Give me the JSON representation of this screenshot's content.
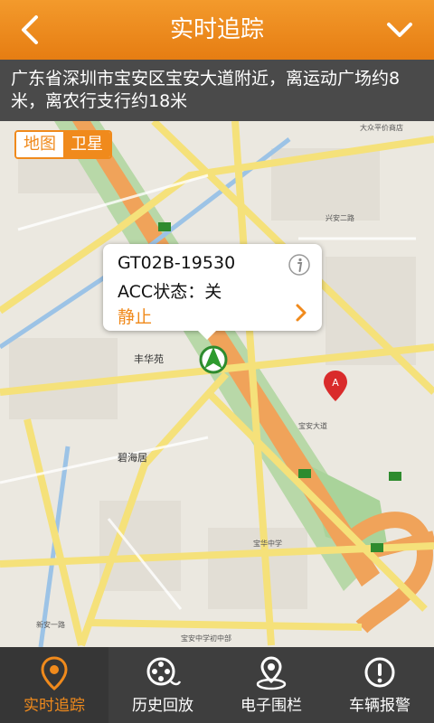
{
  "header": {
    "title": "实时追踪",
    "back_icon": "chevron-left-icon",
    "menu_icon": "chevron-down-icon"
  },
  "address": "广东省深圳市宝安区宝安大道附近，离运动广场约8米，离农行支行约18米",
  "map_type": {
    "map_label": "地图",
    "satellite_label": "卫星",
    "selected": "卫星"
  },
  "map_labels": {
    "fenghuayuan": "丰华苑",
    "bihaiju": "碧海居",
    "dazhong": "大众平价商店",
    "baohua_zhongxue": "宝华中学",
    "xingan_ershi": "兴安二路",
    "badao_a": "宝安大道",
    "xinan_yilu": "新安一路",
    "xingan_road": "宝安中学初中部"
  },
  "popup": {
    "device": "GT02B-19530",
    "acc": "ACC状态：关",
    "status": "静止",
    "info_icon": "info-icon",
    "more_icon": "chevron-right-icon"
  },
  "tabs": [
    {
      "label": "实时追踪",
      "icon": "location-pin-icon",
      "active": true
    },
    {
      "label": "历史回放",
      "icon": "film-reel-icon",
      "active": false
    },
    {
      "label": "电子围栏",
      "icon": "geofence-icon",
      "active": false
    },
    {
      "label": "车辆报警",
      "icon": "alert-icon",
      "active": false
    }
  ],
  "colors": {
    "accent": "#f08a1c",
    "header": "#ec8620",
    "address_bg": "#4a4a4a",
    "tabbar_bg": "#3e3e3e"
  }
}
